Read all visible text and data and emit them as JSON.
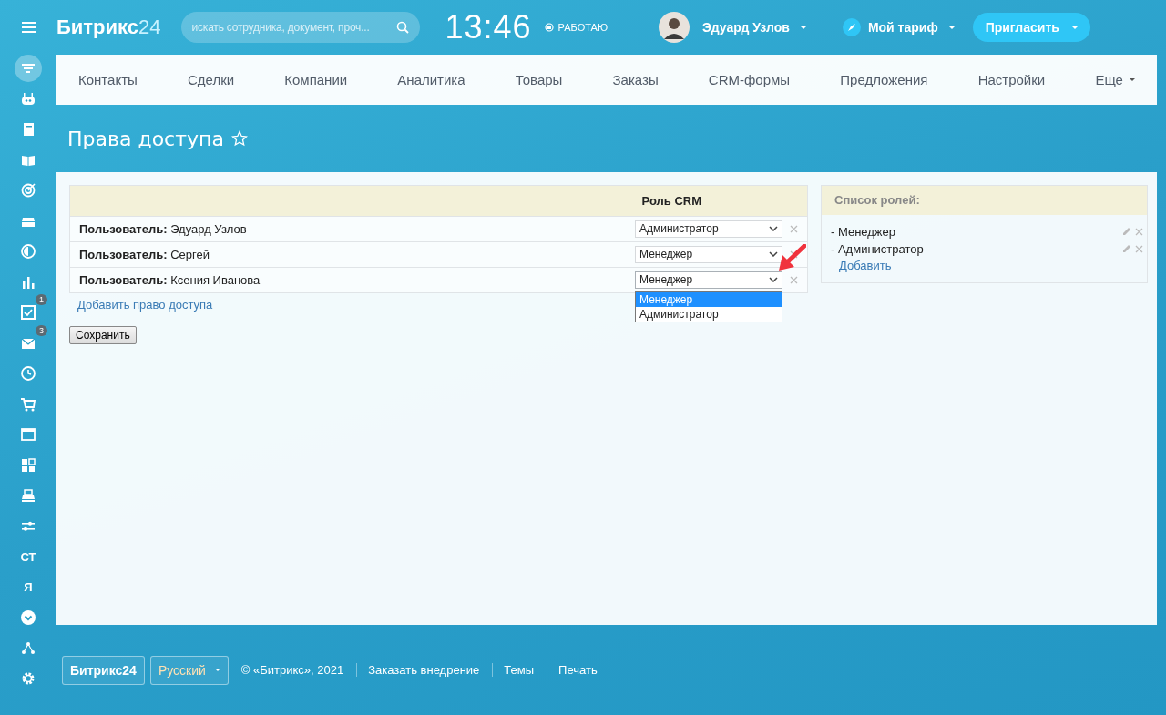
{
  "header": {
    "logo": "Битрикс",
    "logo_number": "24",
    "search": {
      "placeholder": "искать сотрудника, документ, проч..."
    },
    "time": "13:46",
    "work_status": "РАБОТАЮ",
    "user": "Эдуард Узлов",
    "tariff": "Мой тариф",
    "invite": "Пригласить"
  },
  "sidebar": {
    "items": [
      {
        "kind": "icon",
        "selected": true
      },
      {
        "kind": "icon",
        "selected": false
      },
      {
        "kind": "icon",
        "selected": false
      },
      {
        "kind": "icon",
        "selected": false
      },
      {
        "kind": "icon",
        "selected": false
      },
      {
        "kind": "icon",
        "selected": false
      },
      {
        "kind": "icon",
        "selected": false
      },
      {
        "kind": "icon",
        "selected": false
      },
      {
        "kind": "icon",
        "selected": false,
        "badge": "1"
      },
      {
        "kind": "icon",
        "selected": false,
        "badge": "3"
      },
      {
        "kind": "icon",
        "selected": false
      },
      {
        "kind": "icon",
        "selected": false
      },
      {
        "kind": "icon",
        "selected": false
      },
      {
        "kind": "icon",
        "selected": false
      },
      {
        "kind": "icon",
        "selected": false
      },
      {
        "kind": "icon",
        "selected": false
      },
      {
        "kind": "text",
        "selected": false,
        "label": "СТ"
      },
      {
        "kind": "text",
        "selected": false,
        "label": "Я"
      },
      {
        "kind": "icon",
        "selected": false
      },
      {
        "kind": "icon",
        "selected": false
      },
      {
        "kind": "icon",
        "selected": false
      }
    ]
  },
  "nav": {
    "items": [
      "Контакты",
      "Сделки",
      "Компании",
      "Аналитика",
      "Товары",
      "Заказы",
      "CRM-формы",
      "Предложения",
      "Настройки"
    ],
    "more": "Еще"
  },
  "page_title": "Права доступа",
  "access_table": {
    "column": "Роль CRM",
    "options": [
      {
        "label": "Менеджер",
        "selected": true
      },
      {
        "label": "Администратор",
        "selected": false
      }
    ],
    "rows": [
      {
        "label": "Пользователь:",
        "name": "Эдуард Узлов",
        "role": "Администратор",
        "open": false
      },
      {
        "label": "Пользователь:",
        "name": "Сергей",
        "role": "Менеджер",
        "open": false
      },
      {
        "label": "Пользователь:",
        "name": "Ксения Иванова",
        "role": "Менеджер",
        "open": true
      }
    ],
    "add_link": "Добавить право доступа",
    "save": "Сохранить"
  },
  "roles_panel": {
    "title": "Список ролей:",
    "roles": [
      "- Менеджер",
      "- Администратор"
    ],
    "add": "Добавить"
  },
  "footer": {
    "logo": "Битрикс24",
    "language": "Русский",
    "copyright": "© «Битрикс», 2021",
    "links": [
      "Заказать внедрение",
      "Темы",
      "Печать"
    ]
  }
}
